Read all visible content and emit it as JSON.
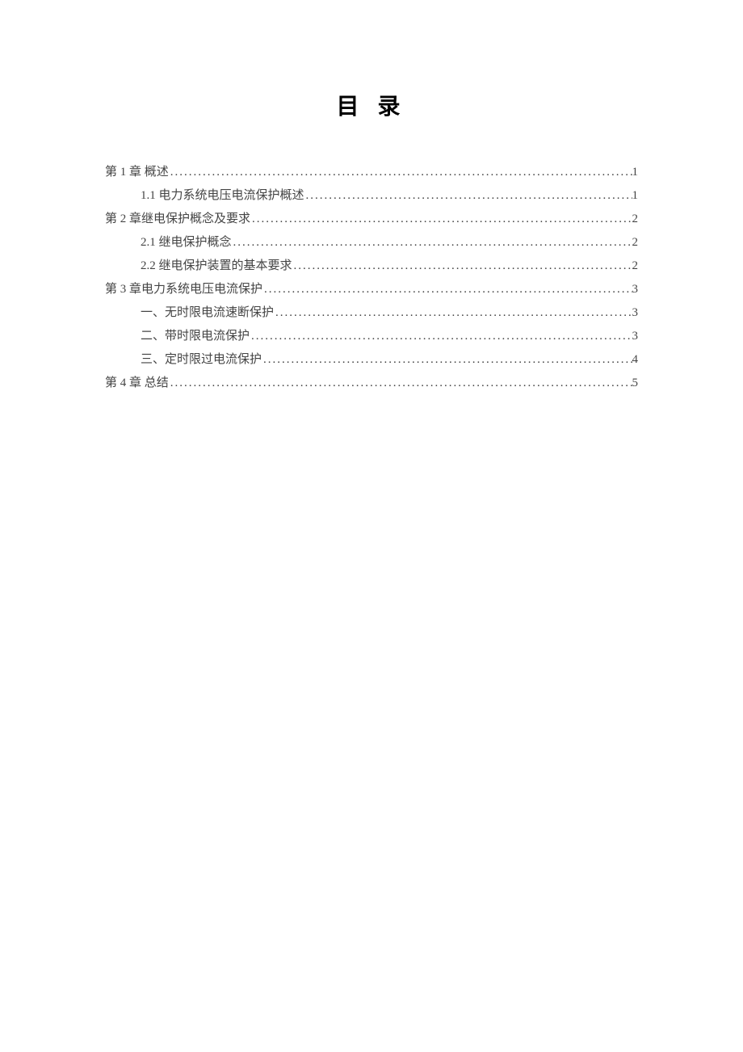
{
  "title": "目 录",
  "toc": [
    {
      "level": 1,
      "label": "第 1 章  概述",
      "page": "1"
    },
    {
      "level": 2,
      "label": "1.1  电力系统电压电流保护概述",
      "page": "1"
    },
    {
      "level": 1,
      "label": "第 2 章继电保护概念及要求",
      "page": "2"
    },
    {
      "level": 2,
      "label": "2.1 继电保护概念",
      "page": "2"
    },
    {
      "level": 2,
      "label": "2.2 继电保护装置的基本要求",
      "page": "2"
    },
    {
      "level": 1,
      "label": "第 3 章电力系统电压电流保护",
      "page": "3"
    },
    {
      "level": 2,
      "label": "一、无时限电流速断保护",
      "page": "3"
    },
    {
      "level": 2,
      "label": "二、带时限电流保护",
      "page": "3"
    },
    {
      "level": 2,
      "label": "三、定时限过电流保护",
      "page": "4"
    },
    {
      "level": 1,
      "label": "第 4 章  总结",
      "page": "5"
    }
  ]
}
